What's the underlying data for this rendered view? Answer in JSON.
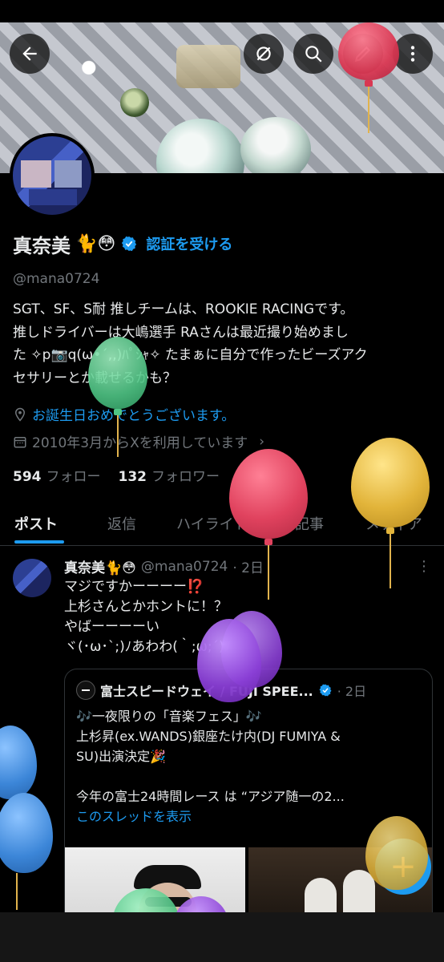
{
  "header": {
    "back_icon": "arrow-left-icon",
    "actions": [
      "unfollow-circle-icon",
      "search-icon",
      "edit-icon",
      "more-vertical-icon"
    ]
  },
  "profile": {
    "name": "真奈美",
    "name_emojis": "🐈😳",
    "verify_cta": "認証を受ける",
    "handle": "@mana0724",
    "bio_lines": [
      "SGT、SF、S耐 推しチームは、ROOKIE RACINGです。",
      "推しドライバーは大嶋選手 RAさんは最近撮り始めまし",
      "た ✧p📷q(ω•´,,)ﾊﾟｼｬ✧ たまぁに自分で作ったビーズアク",
      "セサリーとか載せるかも？"
    ],
    "location": "お誕生日おめでとうございます。",
    "joined": "2010年3月からXを利用しています",
    "following_count": "594",
    "following_label": "フォロー",
    "followers_count": "132",
    "followers_label": "フォロワー"
  },
  "tabs": [
    "ポスト",
    "返信",
    "ハイライト",
    "記事",
    "メディア"
  ],
  "post": {
    "author": "真奈美🐈😳",
    "handle": "@mana0724",
    "time": "· 2日",
    "lines": [
      "マジですかーーーー⁉️",
      "上杉さんとかホントに！？",
      "やばーーーーい",
      "ヾ(･ω･`;)ﾉあわわ(｀;ω;´)ﾉ"
    ],
    "quote": {
      "author": "富士スピードウェイ / FUJI SPEE...",
      "time": "· 2日",
      "lines": [
        "🎶一夜限りの「音楽フェス」🎶",
        "上杉昇(ex.WANDS)銀座たけ内(DJ FUMIYA &",
        "SU)出演決定🎉",
        "",
        "今年の富士24時間レース は “アジア随一の2..."
      ],
      "show_thread": "このスレッドを表示"
    }
  },
  "fab_icon": "plus-icon",
  "colors": {
    "accent": "#1d9bf0",
    "balloon_red": "#e0425e",
    "balloon_yellow": "#e2b43a",
    "balloon_green": "#56c989",
    "balloon_purple": "#8a3fd6",
    "balloon_blue": "#3c86d8"
  }
}
